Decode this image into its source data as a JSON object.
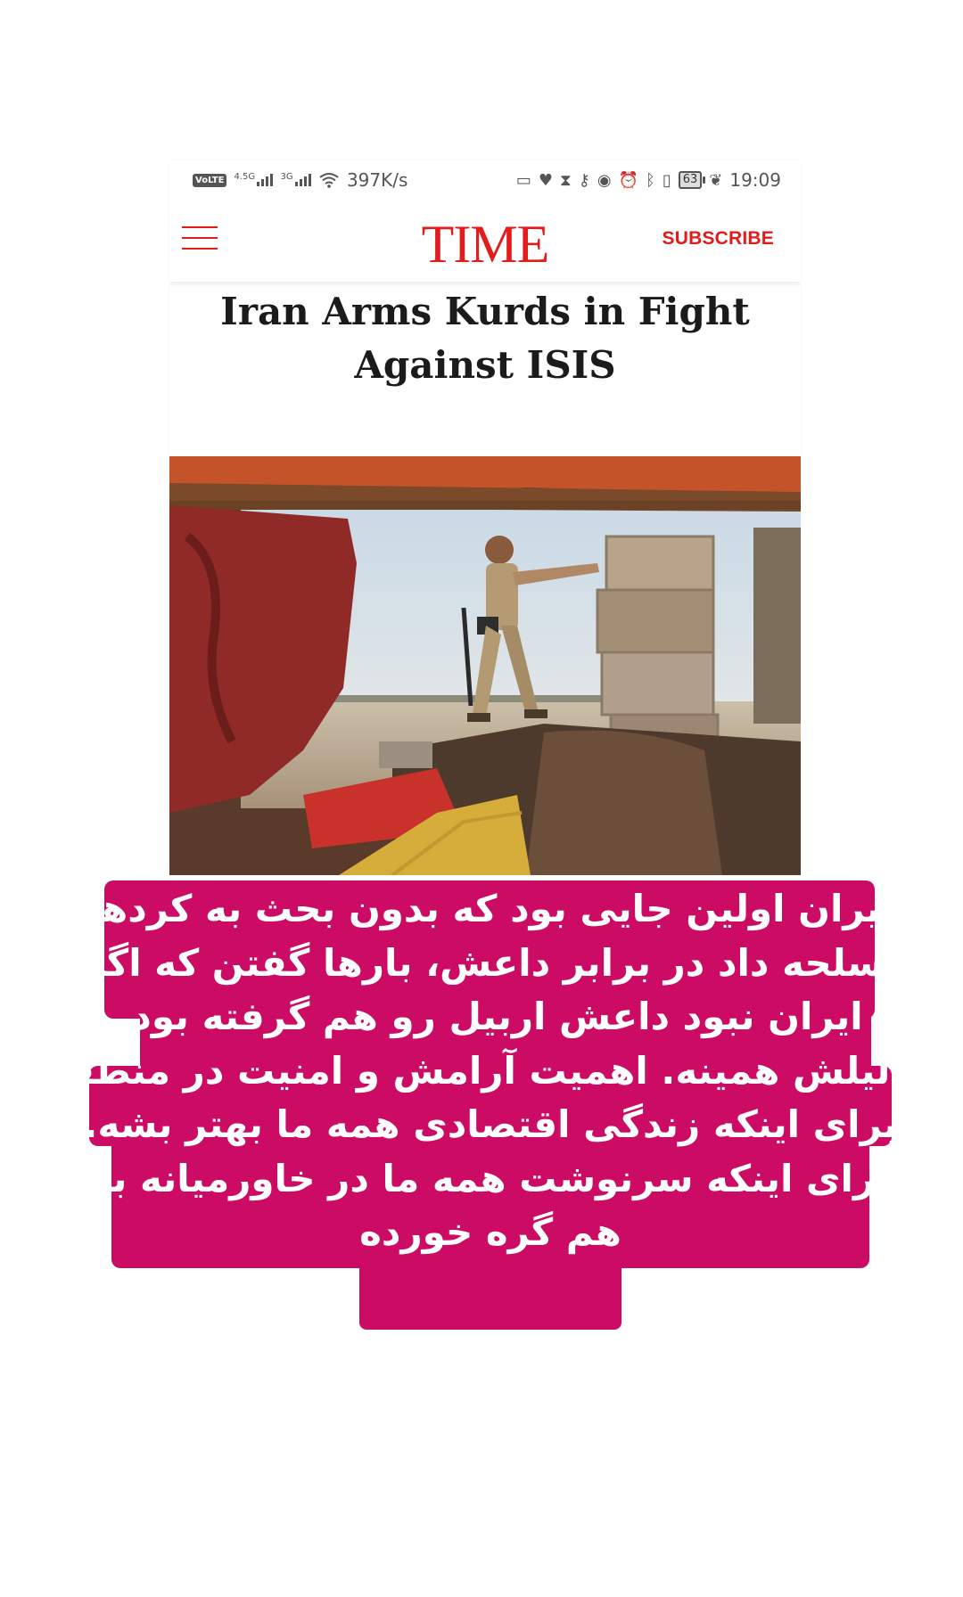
{
  "status_bar": {
    "volte": "VoLTE",
    "net1": "4.5G",
    "net2": "3G",
    "speed": "397K/s",
    "battery": "63",
    "time": "19:09"
  },
  "header": {
    "logo": "TIME",
    "subscribe": "SUBSCRIBE",
    "menu_icon": "hamburger-menu-icon"
  },
  "article": {
    "headline_line1": "Iran Arms Kurds in Fight",
    "headline_line2": "Against ISIS"
  },
  "caption": {
    "lines": [
      "ایران اولین جایی بود که بدون بحث به کردها",
      "اسلحه داد در برابر داعش، بارها گفتن که اگه",
      "ایران نبود داعش اربیل رو هم گرفته بود.",
      "دلیلش همینه. اهمیت آرامش و امنیت در منطقه",
      "برای اینکه زندگی اقتصادی همه ما بهتر بشه.",
      "برای اینکه سرنوشت همه ما در خاورمیانه به",
      "هم گره خورده"
    ]
  },
  "colors": {
    "brand_red": "#e21b1b",
    "caption_bg": "#cc0b65"
  }
}
